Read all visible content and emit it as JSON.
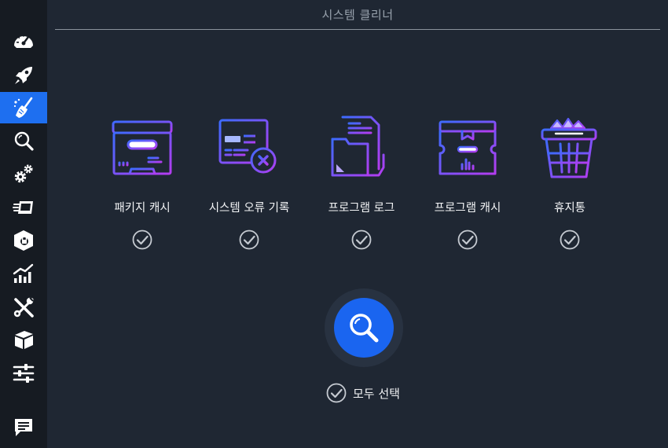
{
  "header": {
    "title": "시스템 클리너"
  },
  "sidebar": {
    "items": [
      {
        "icon": "speedometer-icon",
        "active": false
      },
      {
        "icon": "rocket-icon",
        "active": false
      },
      {
        "icon": "broom-cleaner-icon",
        "active": true
      },
      {
        "icon": "magnifier-icon",
        "active": false
      },
      {
        "icon": "gears-icon",
        "active": false
      },
      {
        "icon": "stacked-cards-icon",
        "active": false
      },
      {
        "icon": "package-lock-icon",
        "active": false
      },
      {
        "icon": "bar-chart-icon",
        "active": false
      },
      {
        "icon": "wrench-screwdriver-icon",
        "active": false
      },
      {
        "icon": "box-icon",
        "active": false
      },
      {
        "icon": "sliders-icon",
        "active": false
      },
      {
        "icon": "chat-icon",
        "active": false
      }
    ]
  },
  "cleaner": {
    "items": [
      {
        "label": "패키지 캐시",
        "checked": true,
        "icon": "package-cache-icon"
      },
      {
        "label": "시스템 오류 기록",
        "checked": true,
        "icon": "error-log-icon"
      },
      {
        "label": "프로그램 로그",
        "checked": true,
        "icon": "folder-log-icon"
      },
      {
        "label": "프로그램 캐시",
        "checked": true,
        "icon": "program-cache-icon"
      },
      {
        "label": "휴지통",
        "checked": true,
        "icon": "trash-basket-icon"
      }
    ],
    "scan_icon": "search-icon",
    "select_all_label": "모두 선택",
    "select_all_checked": true
  },
  "colors": {
    "background": "#1f2733",
    "sidebar": "#161b22",
    "accent": "#1e6ff0",
    "icon_gradient_start": "#3d6bff",
    "icon_gradient_end": "#b43cf0"
  }
}
